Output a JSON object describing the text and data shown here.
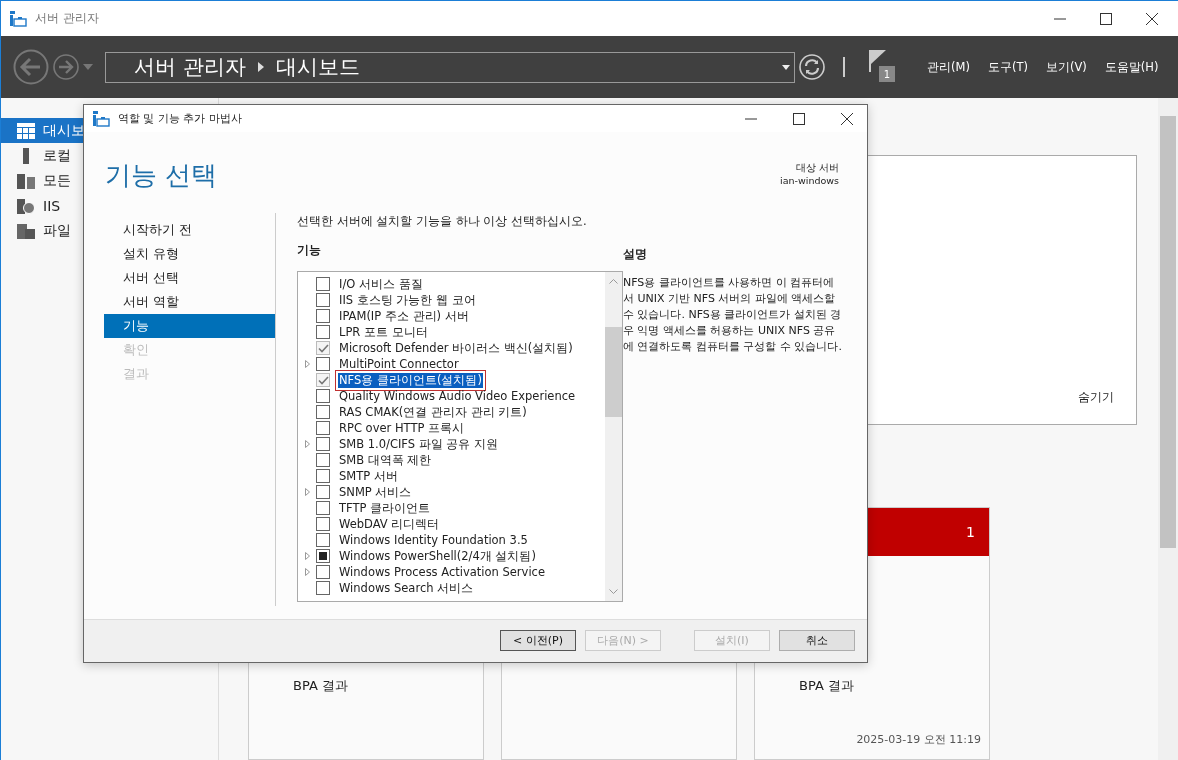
{
  "window": {
    "title": "서버 관리자"
  },
  "toolbar": {
    "breadcrumb": [
      "서버 관리자",
      "대시보드"
    ],
    "flag_count": "1",
    "menus": [
      "관리(M)",
      "도구(T)",
      "보기(V)",
      "도움말(H)"
    ]
  },
  "sidebar": {
    "items": [
      {
        "label": "대시보",
        "selected": true
      },
      {
        "label": "로컬",
        "selected": false
      },
      {
        "label": "모든",
        "selected": false
      },
      {
        "label": "IIS",
        "selected": false
      },
      {
        "label": "파일",
        "selected": false
      }
    ]
  },
  "dashboard": {
    "panel_link": "숨기기",
    "tile_count": "1",
    "cards": [
      {
        "kind": "role",
        "lines": [
          "BPA 결과"
        ]
      },
      {
        "kind": "role"
      },
      {
        "kind": "role",
        "lines": [
          "BPA 결과"
        ],
        "timestamp": "2025-03-19 오전 11:19"
      }
    ]
  },
  "dialog": {
    "title": "역할 및 기능 추가 마법사",
    "heading": "기능 선택",
    "target_label": "대상 서버",
    "target_server": "ian-windows",
    "steps": [
      {
        "label": "시작하기 전",
        "selected": false,
        "disabled": false
      },
      {
        "label": "설치 유형",
        "selected": false,
        "disabled": false
      },
      {
        "label": "서버 선택",
        "selected": false,
        "disabled": false
      },
      {
        "label": "서버 역할",
        "selected": false,
        "disabled": false
      },
      {
        "label": "기능",
        "selected": true,
        "disabled": false
      },
      {
        "label": "확인",
        "selected": false,
        "disabled": true
      },
      {
        "label": "결과",
        "selected": false,
        "disabled": true
      }
    ],
    "instruction": "선택한 서버에 설치할 기능을 하나 이상 선택하십시오.",
    "features_label": "기능",
    "features": [
      {
        "label": "I/O 서비스 품질",
        "checked": false,
        "indeterminate": false,
        "expandable": false,
        "selected": false,
        "outlined": false
      },
      {
        "label": "IIS 호스팅 가능한 웹 코어",
        "checked": false,
        "indeterminate": false,
        "expandable": false,
        "selected": false,
        "outlined": false
      },
      {
        "label": "IPAM(IP 주소 관리) 서버",
        "checked": false,
        "indeterminate": false,
        "expandable": false,
        "selected": false,
        "outlined": false
      },
      {
        "label": "LPR 포트 모니터",
        "checked": false,
        "indeterminate": false,
        "expandable": false,
        "selected": false,
        "outlined": false
      },
      {
        "label": "Microsoft Defender 바이러스 백신(설치됨)",
        "checked": true,
        "indeterminate": false,
        "expandable": false,
        "selected": false,
        "outlined": false
      },
      {
        "label": "MultiPoint Connector",
        "checked": false,
        "indeterminate": false,
        "expandable": true,
        "selected": false,
        "outlined": false
      },
      {
        "label": "NFS용 클라이언트(설치됨)",
        "checked": true,
        "indeterminate": false,
        "expandable": false,
        "selected": true,
        "outlined": true
      },
      {
        "label": "Quality Windows Audio Video Experience",
        "checked": false,
        "indeterminate": false,
        "expandable": false,
        "selected": false,
        "outlined": false
      },
      {
        "label": "RAS CMAK(연결 관리자 관리 키트)",
        "checked": false,
        "indeterminate": false,
        "expandable": false,
        "selected": false,
        "outlined": false
      },
      {
        "label": "RPC over HTTP 프록시",
        "checked": false,
        "indeterminate": false,
        "expandable": false,
        "selected": false,
        "outlined": false
      },
      {
        "label": "SMB 1.0/CIFS 파일 공유 지원",
        "checked": false,
        "indeterminate": false,
        "expandable": true,
        "selected": false,
        "outlined": false
      },
      {
        "label": "SMB 대역폭 제한",
        "checked": false,
        "indeterminate": false,
        "expandable": false,
        "selected": false,
        "outlined": false
      },
      {
        "label": "SMTP 서버",
        "checked": false,
        "indeterminate": false,
        "expandable": false,
        "selected": false,
        "outlined": false
      },
      {
        "label": "SNMP 서비스",
        "checked": false,
        "indeterminate": false,
        "expandable": true,
        "selected": false,
        "outlined": false
      },
      {
        "label": "TFTP 클라이언트",
        "checked": false,
        "indeterminate": false,
        "expandable": false,
        "selected": false,
        "outlined": false
      },
      {
        "label": "WebDAV 리디렉터",
        "checked": false,
        "indeterminate": false,
        "expandable": false,
        "selected": false,
        "outlined": false
      },
      {
        "label": "Windows Identity Foundation 3.5",
        "checked": false,
        "indeterminate": false,
        "expandable": false,
        "selected": false,
        "outlined": false
      },
      {
        "label": "Windows PowerShell(2/4개 설치됨)",
        "checked": false,
        "indeterminate": true,
        "expandable": true,
        "selected": false,
        "outlined": false
      },
      {
        "label": "Windows Process Activation Service",
        "checked": false,
        "indeterminate": false,
        "expandable": true,
        "selected": false,
        "outlined": false
      },
      {
        "label": "Windows Search 서비스",
        "checked": false,
        "indeterminate": false,
        "expandable": false,
        "selected": false,
        "outlined": false
      }
    ],
    "description_label": "설명",
    "description": "NFS용 클라이언트를 사용하면 이 컴퓨터에서 UNIX 기반 NFS 서버의 파일에 액세스할 수 있습니다. NFS용 클라이언트가 설치된 경우 익명 액세스를 허용하는 UNIX NFS 공유에 연결하도록 컴퓨터를 구성할 수 있습니다.",
    "buttons": [
      {
        "label": "< 이전(P)",
        "disabled": false,
        "kind": "default"
      },
      {
        "label": "다음(N) >",
        "disabled": true,
        "kind": "normal"
      },
      {
        "label": "설치(I)",
        "disabled": true,
        "kind": "normal"
      },
      {
        "label": "취소",
        "disabled": false,
        "kind": "normal"
      }
    ]
  }
}
